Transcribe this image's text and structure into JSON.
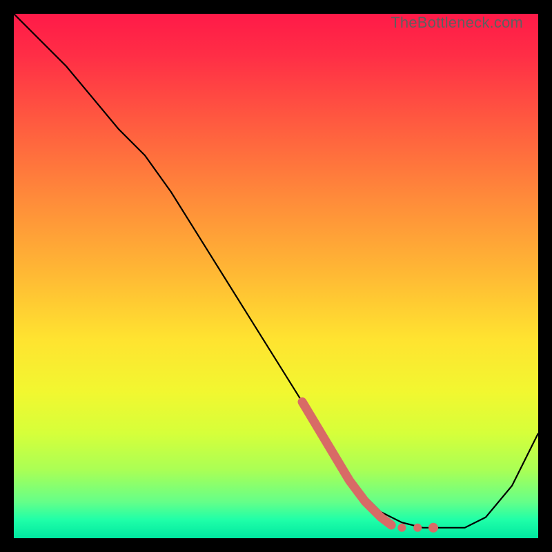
{
  "watermark": "TheBottleneck.com",
  "colors": {
    "frame_bg": "#000000",
    "line": "#000000",
    "marker": "#d86b66",
    "gradient_stops": [
      {
        "offset": 0.0,
        "color": "#ff1a48"
      },
      {
        "offset": 0.08,
        "color": "#ff2e46"
      },
      {
        "offset": 0.2,
        "color": "#ff5840"
      },
      {
        "offset": 0.35,
        "color": "#ff8a3a"
      },
      {
        "offset": 0.5,
        "color": "#ffba34"
      },
      {
        "offset": 0.62,
        "color": "#ffe330"
      },
      {
        "offset": 0.72,
        "color": "#f2f730"
      },
      {
        "offset": 0.8,
        "color": "#d6ff3a"
      },
      {
        "offset": 0.87,
        "color": "#aaff55"
      },
      {
        "offset": 0.93,
        "color": "#66ff88"
      },
      {
        "offset": 0.965,
        "color": "#1fffa8"
      },
      {
        "offset": 1.0,
        "color": "#00e7a0"
      }
    ]
  },
  "chart_data": {
    "type": "line",
    "title": "",
    "xlabel": "",
    "ylabel": "",
    "xlim": [
      0,
      100
    ],
    "ylim": [
      0,
      100
    ],
    "grid": false,
    "legend": false,
    "series": [
      {
        "name": "curve",
        "x": [
          0,
          5,
          10,
          15,
          20,
          25,
          30,
          35,
          40,
          45,
          50,
          55,
          60,
          63,
          66,
          70,
          74,
          78,
          82,
          86,
          90,
          95,
          100
        ],
        "y": [
          100,
          95,
          90,
          84,
          78,
          73,
          66,
          58,
          50,
          42,
          34,
          26,
          18,
          13,
          9,
          5,
          3,
          2,
          2,
          2,
          4,
          10,
          20
        ]
      }
    ],
    "highlight": {
      "name": "highlight-segment",
      "x": [
        55,
        58,
        61,
        64,
        67,
        70,
        72
      ],
      "y": [
        26,
        21,
        16,
        11,
        7,
        4,
        2.5
      ]
    },
    "highlight_dots": {
      "x": [
        74,
        77,
        80
      ],
      "y": [
        2,
        2,
        2
      ]
    }
  }
}
